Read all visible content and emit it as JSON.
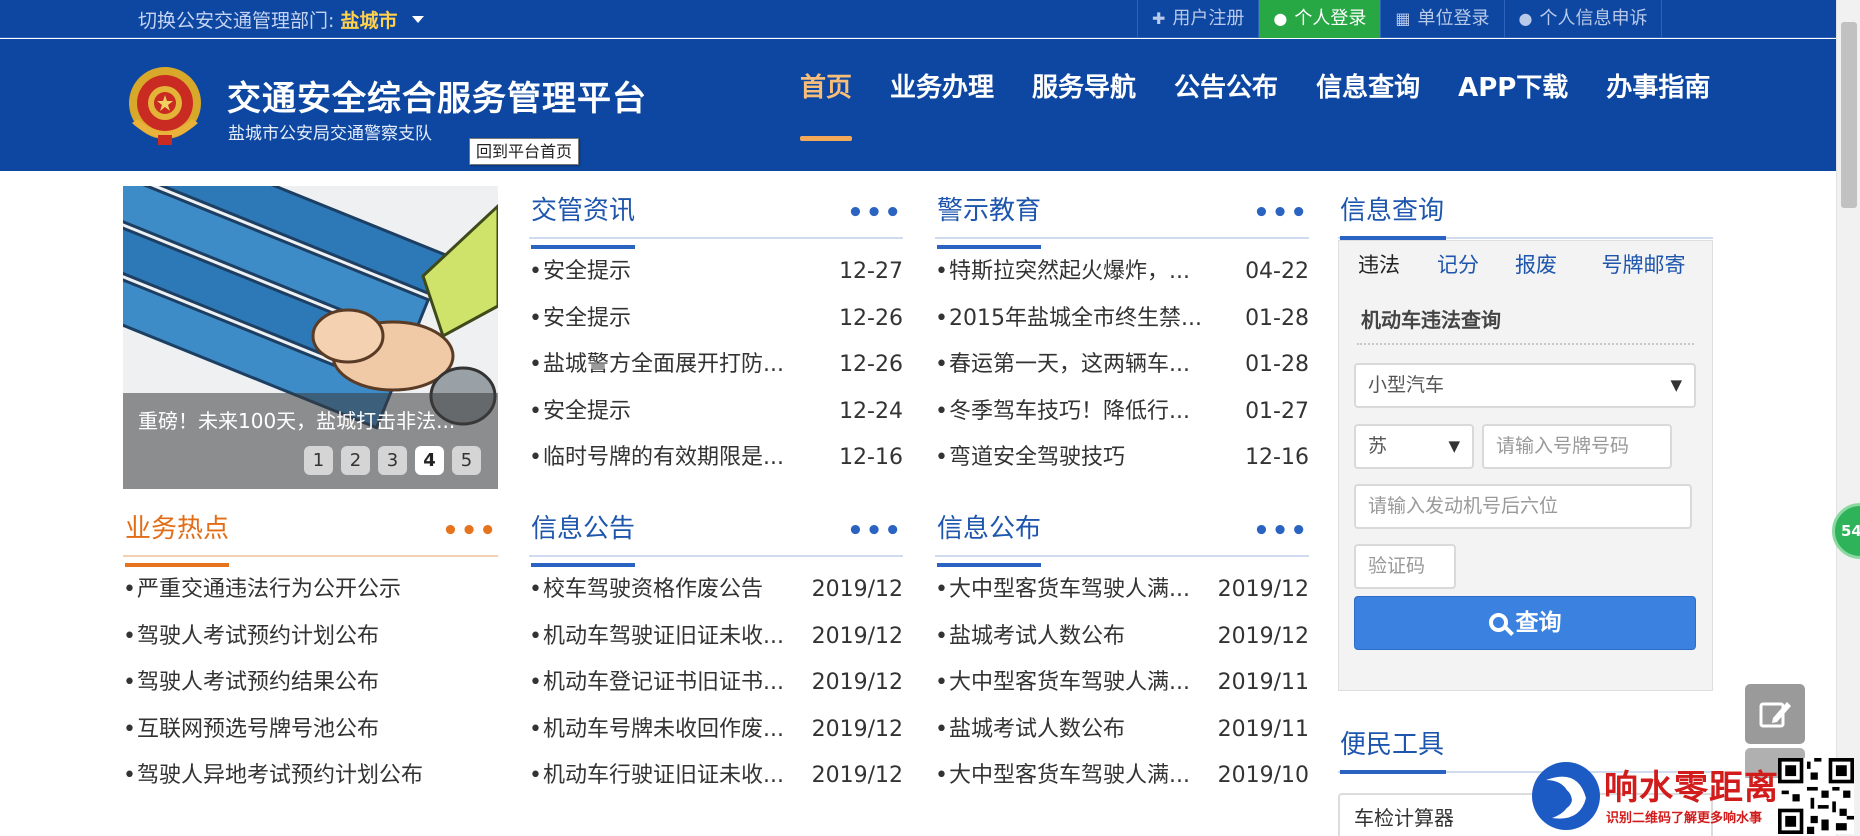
{
  "topbar": {
    "dept_label": "切换公安交通管理部门:",
    "dept_city": "盐城市",
    "links": [
      {
        "label": "用户注册",
        "icon": "plus-icon"
      },
      {
        "label": "个人登录",
        "icon": "user-icon",
        "active": true
      },
      {
        "label": "单位登录",
        "icon": "building-icon"
      },
      {
        "label": "个人信息申诉",
        "icon": "user-icon"
      }
    ]
  },
  "header": {
    "title": "交通安全综合服务管理平台",
    "subtitle": "盐城市公安局交通警察支队",
    "tooltip": "回到平台首页",
    "nav": [
      "首页",
      "业务办理",
      "服务导航",
      "公告公布",
      "信息查询",
      "APP下载",
      "办事指南"
    ]
  },
  "carousel": {
    "caption": "重磅！未来100天，盐城打击非法...",
    "pages": [
      "1",
      "2",
      "3",
      "4",
      "5"
    ],
    "current": 4
  },
  "panels": {
    "jgzx": {
      "title": "交管资讯",
      "items": [
        {
          "text": "安全提示",
          "date": "12-27"
        },
        {
          "text": "安全提示",
          "date": "12-26"
        },
        {
          "text": "盐城警方全面展开打防...",
          "date": "12-26"
        },
        {
          "text": "安全提示",
          "date": "12-24"
        },
        {
          "text": "临时号牌的有效期限是...",
          "date": "12-16"
        }
      ]
    },
    "jsjy": {
      "title": "警示教育",
      "items": [
        {
          "text": "特斯拉突然起火爆炸，...",
          "date": "04-22"
        },
        {
          "text": "2015年盐城全市终生禁...",
          "date": "01-28"
        },
        {
          "text": "春运第一天，这两辆车...",
          "date": "01-28"
        },
        {
          "text": "冬季驾车技巧！降低行...",
          "date": "01-27"
        },
        {
          "text": "弯道安全驾驶技巧",
          "date": "12-16"
        }
      ]
    },
    "ywrd": {
      "title": "业务热点",
      "items": [
        {
          "text": "严重交通违法行为公开公示"
        },
        {
          "text": "驾驶人考试预约计划公布"
        },
        {
          "text": "驾驶人考试预约结果公布"
        },
        {
          "text": "互联网预选号牌号池公布"
        },
        {
          "text": "驾驶人异地考试预约计划公布"
        }
      ]
    },
    "xxgg": {
      "title": "信息公告",
      "items": [
        {
          "text": "校车驾驶资格作废公告",
          "date": "2019/12"
        },
        {
          "text": "机动车驾驶证旧证未收...",
          "date": "2019/12"
        },
        {
          "text": "机动车登记证书旧证书...",
          "date": "2019/12"
        },
        {
          "text": "机动车号牌未收回作废...",
          "date": "2019/12"
        },
        {
          "text": "机动车行驶证旧证未收...",
          "date": "2019/12"
        }
      ]
    },
    "xxgb": {
      "title": "信息公布",
      "items": [
        {
          "text": "大中型客货车驾驶人满...",
          "date": "2019/12"
        },
        {
          "text": "盐城考试人数公布",
          "date": "2019/12"
        },
        {
          "text": "大中型客货车驾驶人满...",
          "date": "2019/11"
        },
        {
          "text": "盐城考试人数公布",
          "date": "2019/11"
        },
        {
          "text": "大中型客货车驾驶人满...",
          "date": "2019/10"
        }
      ]
    }
  },
  "more_label": "•••",
  "bullet": "•",
  "query": {
    "title": "信息查询",
    "tabs": [
      "违法",
      "记分",
      "报废",
      "号牌邮寄"
    ],
    "active_tab": 0,
    "form_title": "机动车违法查询",
    "vehicle_type": "小型汽车",
    "province": "苏",
    "plate_placeholder": "请输入号牌号码",
    "engine_placeholder": "请输入发动机号后六位",
    "captcha_placeholder": "验证码",
    "submit_label": "查询"
  },
  "tools": {
    "title": "便民工具",
    "first_item": "车检计算器"
  },
  "float_badge": "54",
  "watermark": {
    "title": "响水零距离",
    "subtitle": "识别二维码了解更多响水事"
  },
  "colors": {
    "brand_blue": "#0e47a1",
    "link_blue": "#1e56ad",
    "accent_orange": "#e6731e",
    "login_green": "#27a844",
    "city_yellow": "#ffd14d"
  }
}
